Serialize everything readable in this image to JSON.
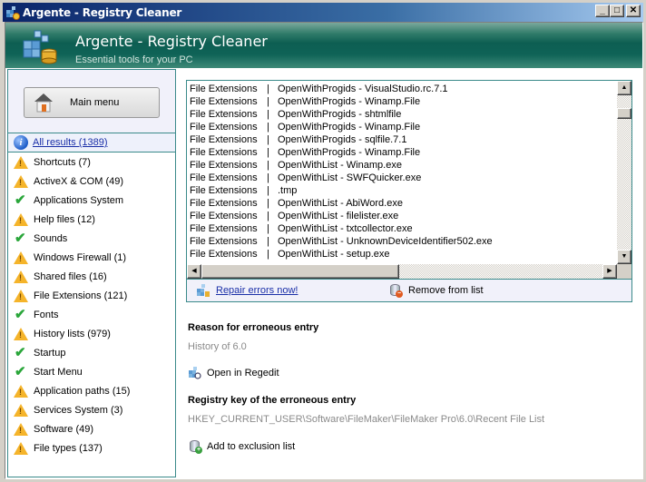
{
  "window": {
    "title": "Argente - Registry Cleaner",
    "controls": {
      "minimize": "_",
      "maximize": "□",
      "close": "✕"
    }
  },
  "header": {
    "title": "Argente - Registry Cleaner",
    "subtitle": "Essential tools for your PC"
  },
  "sidebar": {
    "main_menu_label": "Main menu",
    "all_results": {
      "label": "All results (1389)",
      "icon": "info-icon"
    },
    "items": [
      {
        "label": "Shortcuts (7)",
        "status": "warning"
      },
      {
        "label": "ActiveX & COM (49)",
        "status": "warning"
      },
      {
        "label": "Applications System",
        "status": "ok"
      },
      {
        "label": "Help files (12)",
        "status": "warning"
      },
      {
        "label": "Sounds",
        "status": "ok"
      },
      {
        "label": "Windows Firewall (1)",
        "status": "warning"
      },
      {
        "label": "Shared files (16)",
        "status": "warning"
      },
      {
        "label": "File Extensions (121)",
        "status": "warning"
      },
      {
        "label": "Fonts",
        "status": "ok"
      },
      {
        "label": "History lists (979)",
        "status": "warning"
      },
      {
        "label": "Startup",
        "status": "ok"
      },
      {
        "label": "Start Menu",
        "status": "ok"
      },
      {
        "label": "Application paths (15)",
        "status": "warning"
      },
      {
        "label": "Services System (3)",
        "status": "warning"
      },
      {
        "label": "Software (49)",
        "status": "warning"
      },
      {
        "label": "File types (137)",
        "status": "warning"
      }
    ]
  },
  "results": {
    "separator": "|",
    "rows": [
      {
        "category": "File Extensions",
        "entry": "OpenWithProgids - VisualStudio.rc.7.1"
      },
      {
        "category": "File Extensions",
        "entry": "OpenWithProgids - Winamp.File"
      },
      {
        "category": "File Extensions",
        "entry": "OpenWithProgids - shtmlfile"
      },
      {
        "category": "File Extensions",
        "entry": "OpenWithProgids - Winamp.File"
      },
      {
        "category": "File Extensions",
        "entry": "OpenWithProgids - sqlfile.7.1"
      },
      {
        "category": "File Extensions",
        "entry": "OpenWithProgids - Winamp.File"
      },
      {
        "category": "File Extensions",
        "entry": "OpenWithList - Winamp.exe"
      },
      {
        "category": "File Extensions",
        "entry": "OpenWithList - SWFQuicker.exe"
      },
      {
        "category": "File Extensions",
        "entry": ".tmp"
      },
      {
        "category": "File Extensions",
        "entry": "OpenWithList - AbiWord.exe"
      },
      {
        "category": "File Extensions",
        "entry": "OpenWithList - filelister.exe"
      },
      {
        "category": "File Extensions",
        "entry": "OpenWithList - txtcollector.exe"
      },
      {
        "category": "File Extensions",
        "entry": "OpenWithList - UnknownDeviceIdentifier502.exe"
      },
      {
        "category": "File Extensions",
        "entry": "OpenWithList - setup.exe"
      }
    ],
    "repair_label": "Repair errors now!",
    "remove_label": "Remove from list"
  },
  "details": {
    "reason_heading": "Reason for erroneous entry",
    "reason_value": "History of 6.0",
    "open_regedit_label": "Open in Regedit",
    "key_heading": "Registry key of the erroneous entry",
    "key_value": "HKEY_CURRENT_USER\\Software\\FileMaker\\FileMaker Pro\\6.0\\Recent File List",
    "exclude_label": "Add to exclusion list"
  }
}
